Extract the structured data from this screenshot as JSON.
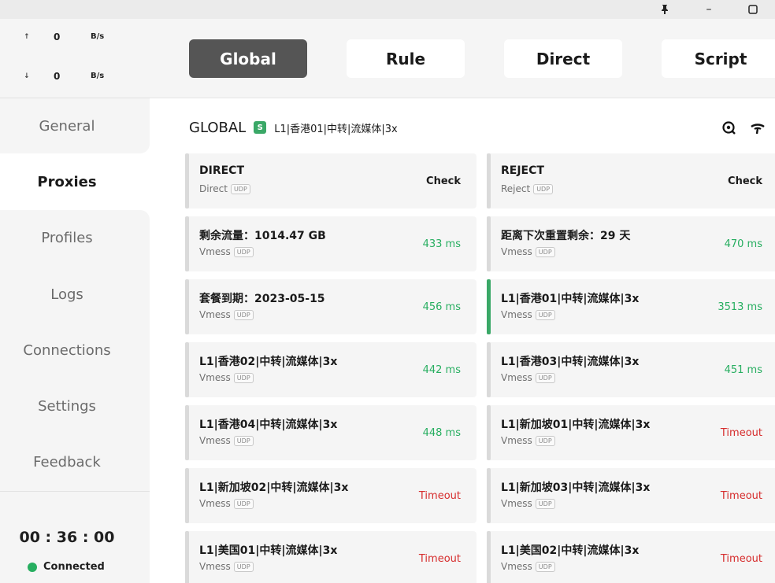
{
  "titlebar": {
    "pin_icon": "pin-icon",
    "minimize_label": "–",
    "maximize_icon": "maximize-icon"
  },
  "traffic": {
    "up_arrow": "↑",
    "up_value": "0",
    "up_unit": "B/s",
    "down_arrow": "↓",
    "down_value": "0",
    "down_unit": "B/s"
  },
  "nav": [
    "General",
    "Proxies",
    "Profiles",
    "Logs",
    "Connections",
    "Settings",
    "Feedback"
  ],
  "nav_active": "Proxies",
  "status": {
    "clock": "00 : 36 : 00",
    "connection": "Connected",
    "connection_color": "#27ae60"
  },
  "modes": [
    "Global",
    "Rule",
    "Direct",
    "Script"
  ],
  "mode_active": "Global",
  "group": {
    "name": "GLOBAL",
    "type_badge": "S",
    "current": "L1|香港01|中转|流媒体|3x"
  },
  "proxies": [
    {
      "name": "DIRECT",
      "type": "Direct",
      "udp": "UDP",
      "delay": "Check",
      "status": "check"
    },
    {
      "name": "REJECT",
      "type": "Reject",
      "udp": "UDP",
      "delay": "Check",
      "status": "check"
    },
    {
      "name": "剩余流量：1014.47 GB",
      "type": "Vmess",
      "udp": "UDP",
      "delay": "433 ms",
      "status": "ok"
    },
    {
      "name": "距离下次重置剩余：29 天",
      "type": "Vmess",
      "udp": "UDP",
      "delay": "470 ms",
      "status": "ok"
    },
    {
      "name": "套餐到期：2023-05-15",
      "type": "Vmess",
      "udp": "UDP",
      "delay": "456 ms",
      "status": "ok"
    },
    {
      "name": "L1|香港01|中转|流媒体|3x",
      "type": "Vmess",
      "udp": "UDP",
      "delay": "3513 ms",
      "status": "ok",
      "selected": true
    },
    {
      "name": "L1|香港02|中转|流媒体|3x",
      "type": "Vmess",
      "udp": "UDP",
      "delay": "442 ms",
      "status": "ok"
    },
    {
      "name": "L1|香港03|中转|流媒体|3x",
      "type": "Vmess",
      "udp": "UDP",
      "delay": "451 ms",
      "status": "ok"
    },
    {
      "name": "L1|香港04|中转|流媒体|3x",
      "type": "Vmess",
      "udp": "UDP",
      "delay": "448 ms",
      "status": "ok"
    },
    {
      "name": "L1|新加坡01|中转|流媒体|3x",
      "type": "Vmess",
      "udp": "UDP",
      "delay": "Timeout",
      "status": "bad"
    },
    {
      "name": "L1|新加坡02|中转|流媒体|3x",
      "type": "Vmess",
      "udp": "UDP",
      "delay": "Timeout",
      "status": "bad"
    },
    {
      "name": "L1|新加坡03|中转|流媒体|3x",
      "type": "Vmess",
      "udp": "UDP",
      "delay": "Timeout",
      "status": "bad"
    },
    {
      "name": "L1|美国01|中转|流媒体|3x",
      "type": "Vmess",
      "udp": "UDP",
      "delay": "Timeout",
      "status": "bad"
    },
    {
      "name": "L1|美国02|中转|流媒体|3x",
      "type": "Vmess",
      "udp": "UDP",
      "delay": "Timeout",
      "status": "bad"
    }
  ],
  "colors": {
    "accent_green": "#27ae60",
    "timeout_red": "#d62d2d",
    "active_mode_bg": "#555555"
  }
}
